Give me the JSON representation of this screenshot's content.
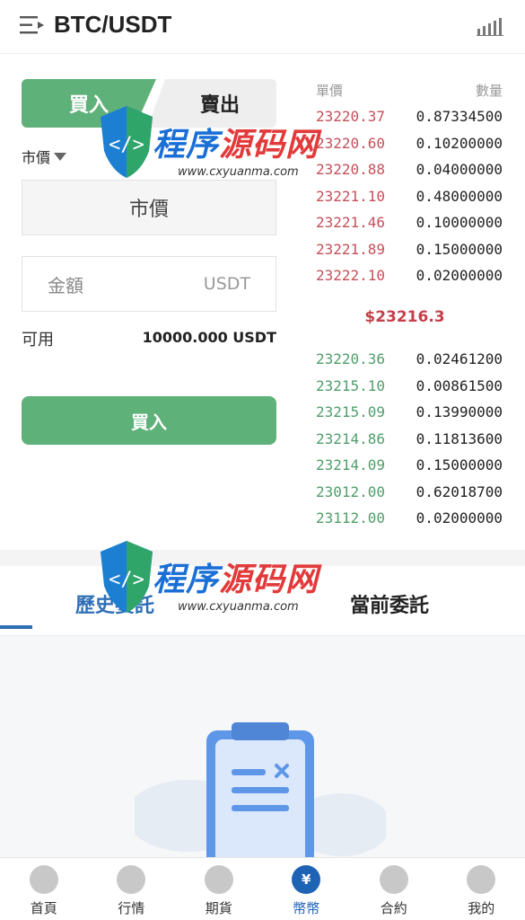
{
  "header": {
    "title": "BTC/USDT",
    "menu_icon": "menu-icon",
    "chart_icon": "bar-chart-icon"
  },
  "trade": {
    "tab_buy": "買入",
    "tab_sell": "賣出",
    "order_type": "市價",
    "price_field": "市價",
    "amount_placeholder": "金額",
    "amount_unit": "USDT",
    "available_label": "可用",
    "available_value": "10000.000 USDT",
    "buy_button": "買入"
  },
  "orderbook": {
    "price_header": "單價",
    "amount_header": "數量",
    "asks": [
      {
        "price": "23220.37",
        "amount": "0.87334500"
      },
      {
        "price": "23220.60",
        "amount": "0.10200000"
      },
      {
        "price": "23220.88",
        "amount": "0.04000000"
      },
      {
        "price": "23221.10",
        "amount": "0.48000000"
      },
      {
        "price": "23221.46",
        "amount": "0.10000000"
      },
      {
        "price": "23221.89",
        "amount": "0.15000000"
      },
      {
        "price": "23222.10",
        "amount": "0.02000000"
      }
    ],
    "last_price": "$23216.3",
    "bids": [
      {
        "price": "23220.36",
        "amount": "0.02461200"
      },
      {
        "price": "23215.10",
        "amount": "0.00861500"
      },
      {
        "price": "23215.09",
        "amount": "0.13990000"
      },
      {
        "price": "23214.86",
        "amount": "0.11813600"
      },
      {
        "price": "23214.09",
        "amount": "0.15000000"
      },
      {
        "price": "23012.00",
        "amount": "0.62018700"
      },
      {
        "price": "23112.00",
        "amount": "0.02000000"
      }
    ],
    "ask_color": "#c4505a",
    "bid_color": "#4f9e6a"
  },
  "orders": {
    "tab_history": "歷史委託",
    "tab_current": "當前委託"
  },
  "nav": {
    "items": [
      {
        "label": "首頁",
        "icon": "home-icon"
      },
      {
        "label": "行情",
        "icon": "market-icon"
      },
      {
        "label": "期貨",
        "icon": "futures-icon"
      },
      {
        "label": "幣幣",
        "icon": "yuan-icon",
        "glyph": "¥"
      },
      {
        "label": "合約",
        "icon": "contract-icon"
      },
      {
        "label": "我的",
        "icon": "profile-icon"
      }
    ],
    "active_index": 3,
    "active_color": "#1f63b5"
  },
  "watermark": {
    "text_blue": "程序",
    "text_red": "源码网",
    "url": "www.cxyuanma.com"
  },
  "colors": {
    "buy_green": "#5fb17a",
    "accent_blue": "#2f6fb5",
    "last_price_red": "#c4404a"
  }
}
